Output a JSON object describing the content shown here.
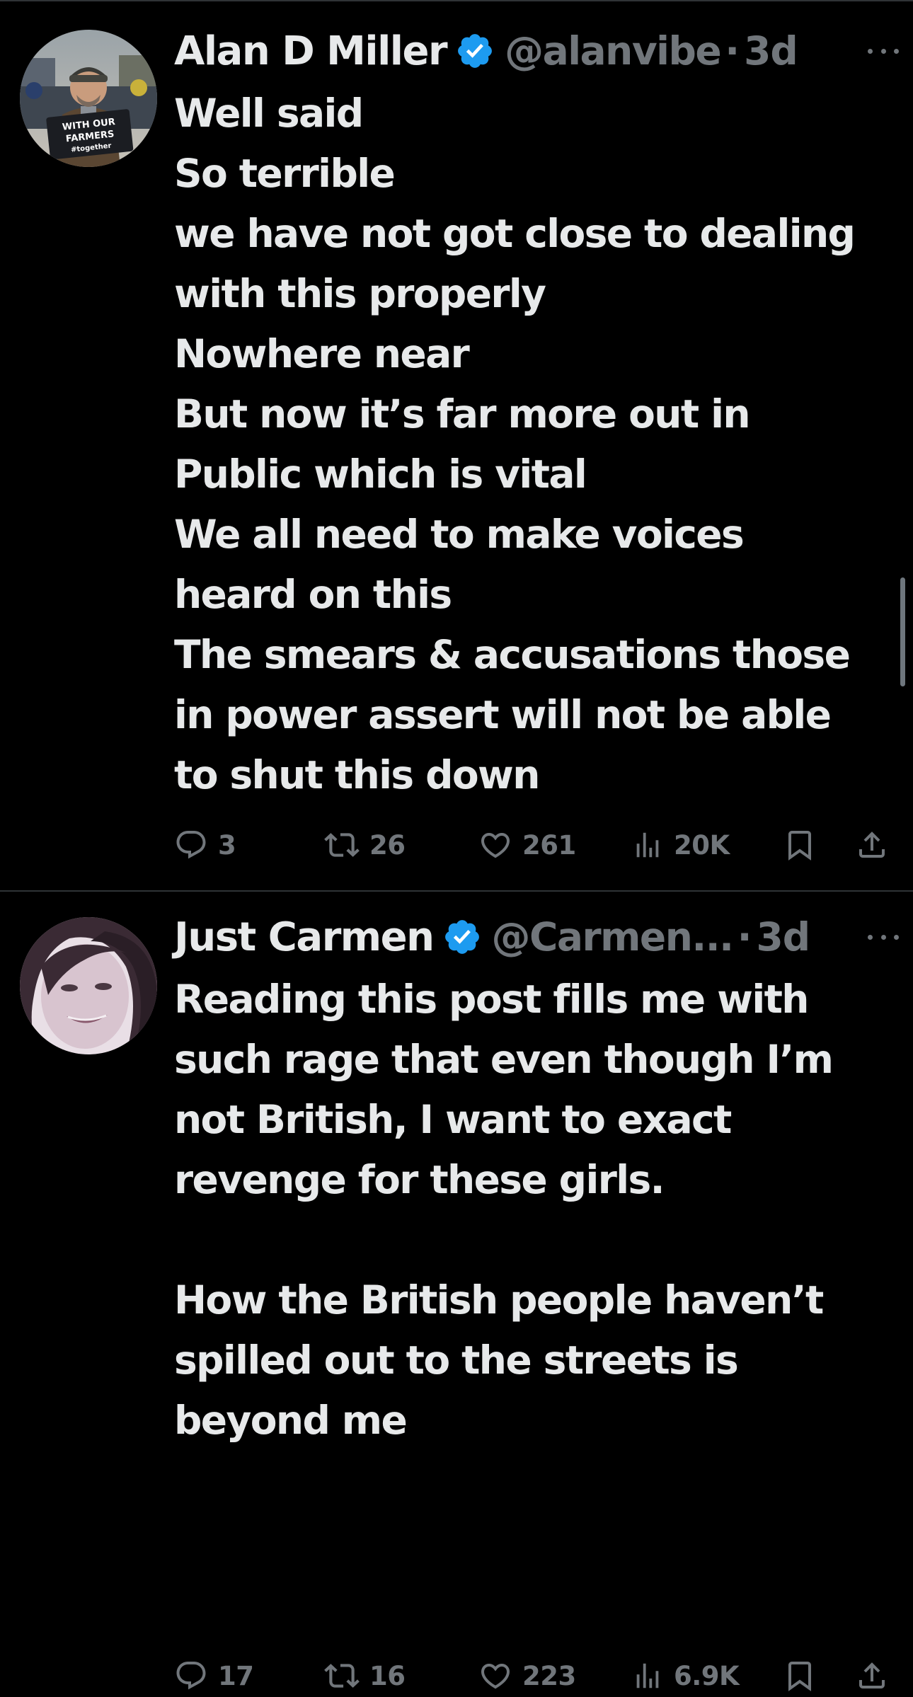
{
  "colors": {
    "background": "#000000",
    "text_primary": "#e7e9ea",
    "text_secondary": "#71767b",
    "verified_blue": "#1d9bf0",
    "divider": "#2f3336"
  },
  "tweets": [
    {
      "author": {
        "display_name": "Alan D Miller",
        "handle": "@alanvibe",
        "verified": true,
        "avatar_sign_text": [
          "WITH OUR",
          "FARMERS",
          "#together"
        ]
      },
      "separator": "·",
      "time": "3d",
      "more_icon": "more-horizontal-icon",
      "text_lines": [
        "Well said",
        "So terrible",
        "we have not got close to dealing",
        "with this properly",
        "Nowhere near",
        "But now it’s far more out in",
        "Public which is vital",
        "We all need to make voices",
        "heard on this",
        "The smears & accusations those",
        "in power assert will not be able",
        "to shut this down"
      ],
      "actions": {
        "replies": "3",
        "reposts": "26",
        "likes": "261",
        "views": "20K"
      }
    },
    {
      "author": {
        "display_name": "Just Carmen",
        "handle": "@Carmen...",
        "verified": true
      },
      "separator": "·",
      "time": "3d",
      "more_icon": "more-horizontal-icon",
      "text_lines": [
        "Reading this post fills me with",
        "such rage that even though I’m",
        "not British, I want to exact",
        "revenge for these girls.",
        "",
        "How the British people haven’t",
        "spilled out to the streets is",
        "beyond me"
      ],
      "actions": {
        "replies": "17",
        "reposts": "16",
        "likes": "223",
        "views": "6.9K"
      }
    }
  ]
}
